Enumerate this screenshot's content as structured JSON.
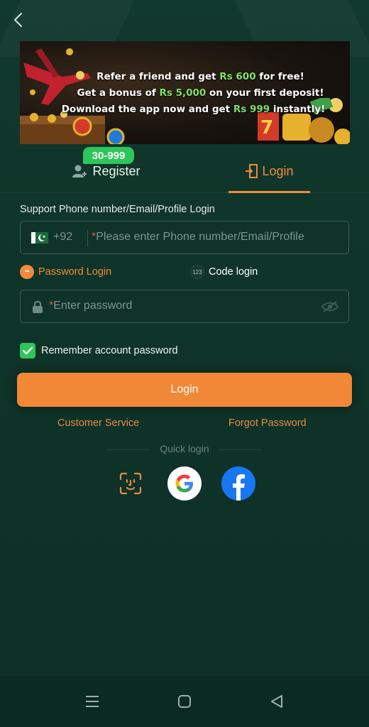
{
  "header": {
    "back_icon": "chevron-left-icon"
  },
  "banner": {
    "line1_prefix": "Refer a friend and get ",
    "line1_amount": "Rs 600",
    "line1_suffix": " for free!",
    "line2_prefix": "Get a bonus of ",
    "line2_amount": "Rs 5,000",
    "line2_suffix": " on your first deposit!",
    "line3_prefix": "Download the app now and get ",
    "line3_amount": "Rs 999",
    "line3_suffix": " instantly!"
  },
  "tabs": {
    "register_label": "Register",
    "register_badge": "30-999",
    "login_label": "Login",
    "active": "login"
  },
  "form": {
    "section_label": "Support Phone number/Email/Profile Login",
    "country_code": "+92",
    "phone_required_mark": "*",
    "phone_placeholder": "Please enter Phone number/Email/Profile",
    "mode_password_label": "Password Login",
    "mode_password_icon": "**",
    "mode_code_label": "Code login",
    "mode_code_icon": "123",
    "password_required_mark": "*",
    "password_placeholder": "Enter password",
    "remember_label": "Remember account password",
    "remember_checked": true,
    "login_button": "Login"
  },
  "links": {
    "customer_service": "Customer Service",
    "forgot_password": "Forgot Password"
  },
  "quick_login": {
    "label": "Quick login",
    "providers": [
      "face-id",
      "google",
      "facebook"
    ]
  },
  "colors": {
    "accent": "#f18838",
    "background": "#0f3429",
    "success": "#2ec65a",
    "highlight": "#7ee06a"
  }
}
